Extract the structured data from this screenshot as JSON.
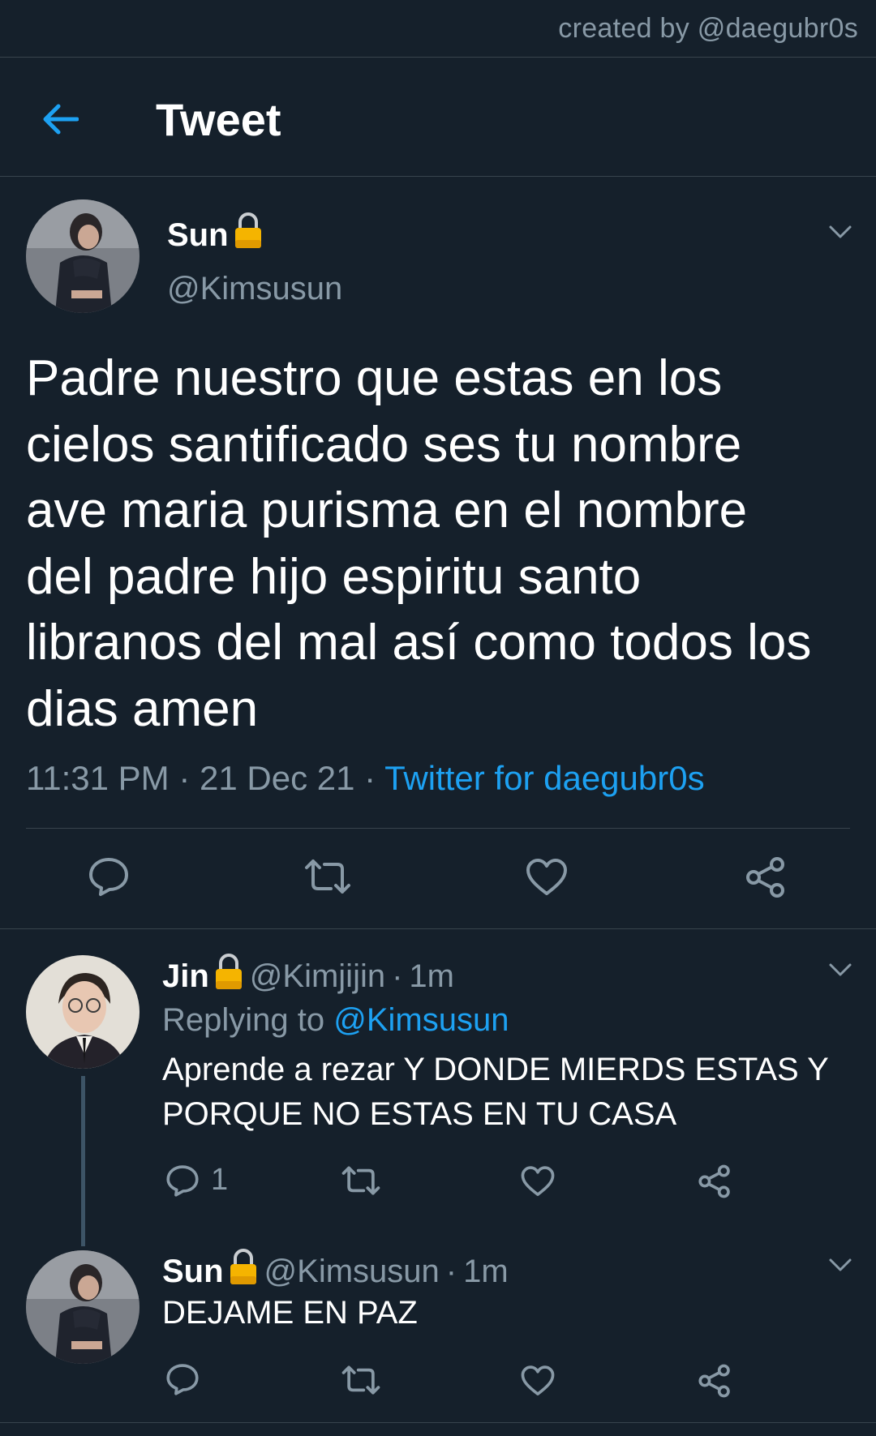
{
  "credit": "created by @daegubr0s",
  "header": {
    "title": "Tweet"
  },
  "main_tweet": {
    "author_name": "Sun",
    "handle": "@Kimsusun",
    "text_lines": [
      "Padre nuestro que estas en los",
      "cielos santificado ses tu nombre",
      "ave maria purisma en el nombre",
      "del padre hijo espiritu santo",
      "libranos del mal así como todos los",
      "dias amen"
    ],
    "time": "11:31 PM",
    "date": "21 Dec 21",
    "separator": "·",
    "source": "Twitter for daegubr0s"
  },
  "replies": [
    {
      "author_name": "Jin",
      "handle": "@Kimjijin",
      "time": "1m",
      "replying_to_label": "Replying to",
      "replying_to": "@Kimsusun",
      "text_lines": [
        "Aprende a rezar Y DONDE MIERDS ESTAS Y",
        "PORQUE NO ESTAS EN TU CASA"
      ],
      "reply_count": "1"
    },
    {
      "author_name": "Sun",
      "handle": "@Kimsusun",
      "time": "1m",
      "text_lines": [
        "DEJAME EN PAZ"
      ]
    }
  ],
  "colors": {
    "background": "#15202b",
    "divider": "#38444d",
    "secondary_text": "#8899a6",
    "accent": "#1da1f2",
    "lock": "#f5b400"
  },
  "icons": [
    "back-arrow-icon",
    "lock-icon",
    "chevron-down-icon",
    "reply-icon",
    "retweet-icon",
    "like-icon",
    "share-icon"
  ]
}
